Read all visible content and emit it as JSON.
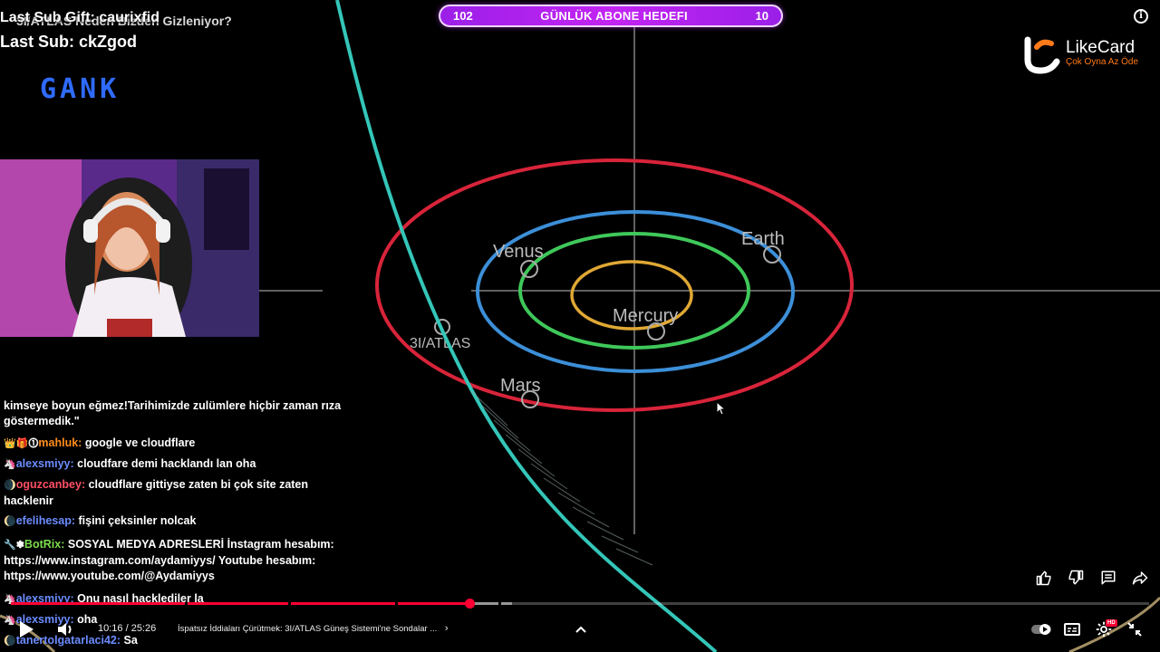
{
  "stream_overlay": {
    "video_title_ghost": "3I/ATLAS Neden Bizden Gizleniyor?",
    "last_sub_gift": "Last Sub Gift: caurixfid",
    "last_sub": "Last Sub: ckZgod",
    "gank_logo_text": "GANK",
    "goal": {
      "left_count": "102",
      "title": "GÜNLÜK ABONE HEDEFI",
      "right_count": "10"
    },
    "sponsor": {
      "name": "LikeCard",
      "slogan": "Çok Oyna  Az Öde"
    }
  },
  "orbit_labels": {
    "venus": "Venus",
    "earth": "Earth",
    "mercury": "Mercury",
    "atlas": "3I/ATLAS",
    "mars": "Mars"
  },
  "chat": [
    {
      "user": "",
      "text": "kimseye boyun eğmez!Tarihimizde zulümlere hiçbir zaman rıza göstermedik.\"",
      "color": "#ffffff",
      "badges": ""
    },
    {
      "user": "mahluk:",
      "text": "google ve cloudflare",
      "color": "#ff8c1a",
      "badges": "👑🎁⓵"
    },
    {
      "user": "alexsmiyy:",
      "text": "cloudfare demi hacklandı lan oha",
      "color": "#6b8cff",
      "badges": "🦄"
    },
    {
      "user": "oguzcanbey:",
      "text": "cloudflare gittiyse zaten bi çok site zaten hacklenir",
      "color": "#ff4f64",
      "badges": "🌒"
    },
    {
      "user": "efelihesap:",
      "text": "fişini çeksinler nolcak",
      "color": "#6b8cff",
      "badges": "🌘"
    },
    {
      "user": "BotRix:",
      "text": "SOSYAL MEDYA ADRESLERİ İnstagram hesabım: https://www.instagram.com/aydamiyys/ Youtube hesabım: https://www.youtube.com/@Aydamiyys",
      "color": "#7ddc4c",
      "badges": "🔧✽"
    },
    {
      "user": "alexsmiyy:",
      "text": "Onu nasıl hacklediler la",
      "color": "#6b8cff",
      "badges": "🦄"
    },
    {
      "user": "alexsmiyy:",
      "text": "oha",
      "color": "#6b8cff",
      "badges": "🦄"
    },
    {
      "user": "tanertolgatarlaci42:",
      "text": "Sa",
      "color": "#6b8cff",
      "badges": "🌘"
    }
  ],
  "player": {
    "current_time": "10:16",
    "duration": "25:26",
    "time_text": "10:16 / 25:26",
    "chapter_title": "İspatsız İddiaları Çürütmek: 3I/ATLAS Güneş Sistemi'ne Sondalar ...",
    "played_fraction": 0.403,
    "loaded_fraction": 0.44,
    "hd_badge": "HD"
  },
  "icons": {
    "play": "play-icon",
    "volume": "volume-icon",
    "like": "thumbs-up-icon",
    "dislike": "thumbs-down-icon",
    "comment": "comment-icon",
    "share": "share-icon",
    "settings": "gear-icon",
    "captions": "captions-icon",
    "autoplay": "autoplay-toggle-icon",
    "exit_fullscreen": "exit-fullscreen-icon",
    "info": "info-icon",
    "expand": "chevron-up-icon"
  },
  "colors": {
    "goal_bar": "#b01ff0",
    "progress_played": "#ff0033",
    "orbit_mars": "#d8243a",
    "orbit_earth": "#3c8fd8",
    "orbit_venus": "#3fc85a",
    "orbit_mercury": "#e0a834",
    "comet_path": "#34c6b8",
    "gank_logo": "#2f6bff",
    "sponsor_orange": "#ff7a1a"
  }
}
